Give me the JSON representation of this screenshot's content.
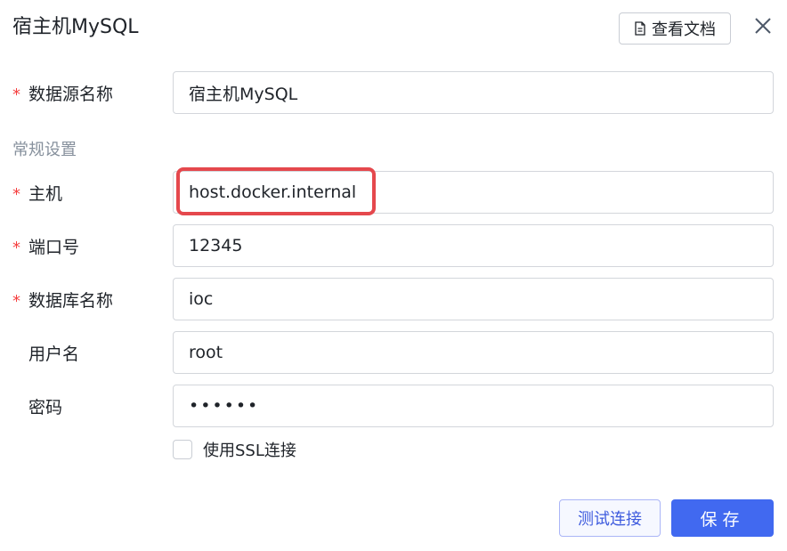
{
  "dialog": {
    "title": "宿主机MySQL",
    "docs_label": "查看文档",
    "icons": {
      "docs": "document-icon",
      "close": "close-icon"
    }
  },
  "fields": {
    "datasource_name": {
      "label": "数据源名称",
      "value": "宿主机MySQL",
      "required": true
    },
    "section_title": "常规设置",
    "host": {
      "label": "主机",
      "value": "host.docker.internal",
      "required": true
    },
    "port": {
      "label": "端口号",
      "value": "12345",
      "required": true
    },
    "database_name": {
      "label": "数据库名称",
      "value": "ioc",
      "required": true
    },
    "username": {
      "label": "用户名",
      "value": "root",
      "required": false
    },
    "password": {
      "label": "密码",
      "value": "••••••",
      "required": false
    },
    "required_mark": "*"
  },
  "ssl": {
    "label": "使用SSL连接",
    "checked": false
  },
  "buttons": {
    "test": "测试连接",
    "save": "保存"
  },
  "colors": {
    "primary": "#4169f0",
    "required": "#f53f3f",
    "highlight": "#e5484d",
    "muted": "#86909c"
  }
}
